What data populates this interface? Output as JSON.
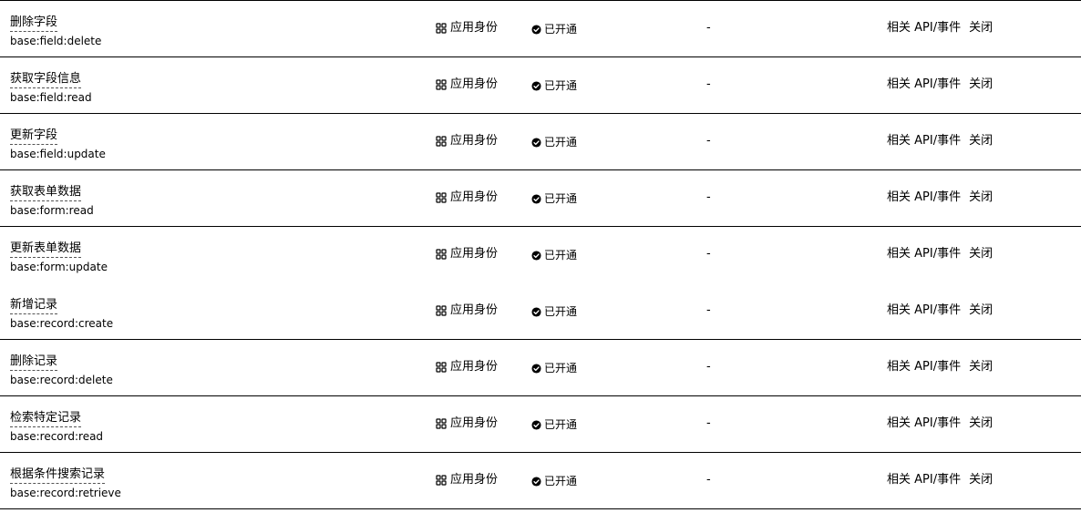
{
  "colors": {
    "text": "#000000",
    "border": "#000000",
    "background": "#ffffff"
  },
  "rows": [
    {
      "name": "删除字段",
      "code": "base:field:delete",
      "identity": "应用身份",
      "identity_icon": "app-grid-icon",
      "status": "已开通",
      "status_icon": "check-circle-icon",
      "extra": "-",
      "related": "相关 API/事件",
      "close": "关闭",
      "border": true
    },
    {
      "name": "获取字段信息",
      "code": "base:field:read",
      "identity": "应用身份",
      "identity_icon": "app-grid-icon",
      "status": "已开通",
      "status_icon": "check-circle-icon",
      "extra": "-",
      "related": "相关 API/事件",
      "close": "关闭",
      "border": true
    },
    {
      "name": "更新字段",
      "code": "base:field:update",
      "identity": "应用身份",
      "identity_icon": "app-grid-icon",
      "status": "已开通",
      "status_icon": "check-circle-icon",
      "extra": "-",
      "related": "相关 API/事件",
      "close": "关闭",
      "border": true
    },
    {
      "name": "获取表单数据",
      "code": "base:form:read",
      "identity": "应用身份",
      "identity_icon": "app-grid-icon",
      "status": "已开通",
      "status_icon": "check-circle-icon",
      "extra": "-",
      "related": "相关 API/事件",
      "close": "关闭",
      "border": true
    },
    {
      "name": "更新表单数据",
      "code": "base:form:update",
      "identity": "应用身份",
      "identity_icon": "app-grid-icon",
      "status": "已开通",
      "status_icon": "check-circle-icon",
      "extra": "-",
      "related": "相关 API/事件",
      "close": "关闭",
      "border": false
    },
    {
      "name": "新增记录",
      "code": "base:record:create",
      "identity": "应用身份",
      "identity_icon": "app-grid-icon",
      "status": "已开通",
      "status_icon": "check-circle-icon",
      "extra": "-",
      "related": "相关 API/事件",
      "close": "关闭",
      "border": true
    },
    {
      "name": "删除记录",
      "code": "base:record:delete",
      "identity": "应用身份",
      "identity_icon": "app-grid-icon",
      "status": "已开通",
      "status_icon": "check-circle-icon",
      "extra": "-",
      "related": "相关 API/事件",
      "close": "关闭",
      "border": true
    },
    {
      "name": "检索特定记录",
      "code": "base:record:read",
      "identity": "应用身份",
      "identity_icon": "app-grid-icon",
      "status": "已开通",
      "status_icon": "check-circle-icon",
      "extra": "-",
      "related": "相关 API/事件",
      "close": "关闭",
      "border": true
    },
    {
      "name": "根据条件搜索记录",
      "code": "base:record:retrieve",
      "identity": "应用身份",
      "identity_icon": "app-grid-icon",
      "status": "已开通",
      "status_icon": "check-circle-icon",
      "extra": "-",
      "related": "相关 API/事件",
      "close": "关闭",
      "border": true
    }
  ]
}
